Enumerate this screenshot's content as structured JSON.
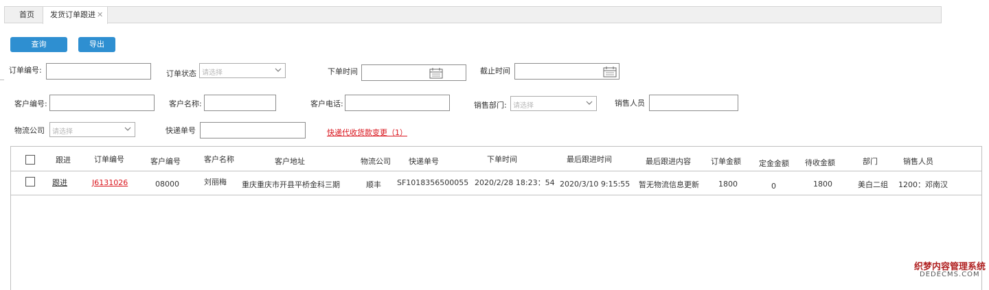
{
  "tabs": {
    "home": "首页",
    "active": "发货订单跟进"
  },
  "toolbar": {
    "query": "查询",
    "export": "导出"
  },
  "filters": {
    "order_no": "订单编号:",
    "order_status": "订单状态",
    "order_status_ph": "请选择",
    "order_time": "下单时间",
    "cutoff_time": "截止时间",
    "customer_no": "客户编号:",
    "customer_name": "客户名称:",
    "customer_phone": "客户电话:",
    "sales_dept": "销售部门:",
    "sales_dept_ph": "请选择",
    "salesperson": "销售人员",
    "logistics": "物流公司",
    "logistics_ph": "请选择",
    "express_no": "快递单号",
    "cod_change_link": "快递代收货款变更（1）"
  },
  "table": {
    "columns": [
      "跟进",
      "订单编号",
      "客户编号",
      "客户名称",
      "客户地址",
      "物流公司",
      "快递单号",
      "下单时间",
      "最后跟进时间",
      "最后跟进内容",
      "订单金额",
      "定金金额",
      "待收金额",
      "部门",
      "销售人员"
    ],
    "rows": [
      {
        "follow": "跟进",
        "order_no": "J6131026",
        "customer_no": "08000",
        "customer_name": "刘丽梅",
        "address": "重庆重庆市开县平桥金科三期",
        "logistics": "顺丰",
        "express_no": "SF1018356500055",
        "order_time": "2020/2/28 18:23：54",
        "last_follow_time": "2020/3/10 9:15:55",
        "last_follow_content": "暂无物流信息更新",
        "order_amount": "1800",
        "deposit": "0",
        "due": "1800",
        "dept": "美白二组",
        "salesperson": "1200：邓南汉"
      }
    ]
  },
  "watermark": {
    "line1": "织梦内容管理系统",
    "line2": "DEDECMS.COM"
  },
  "colors": {
    "primary": "#2e8fd1",
    "link_red": "#d9141c"
  }
}
